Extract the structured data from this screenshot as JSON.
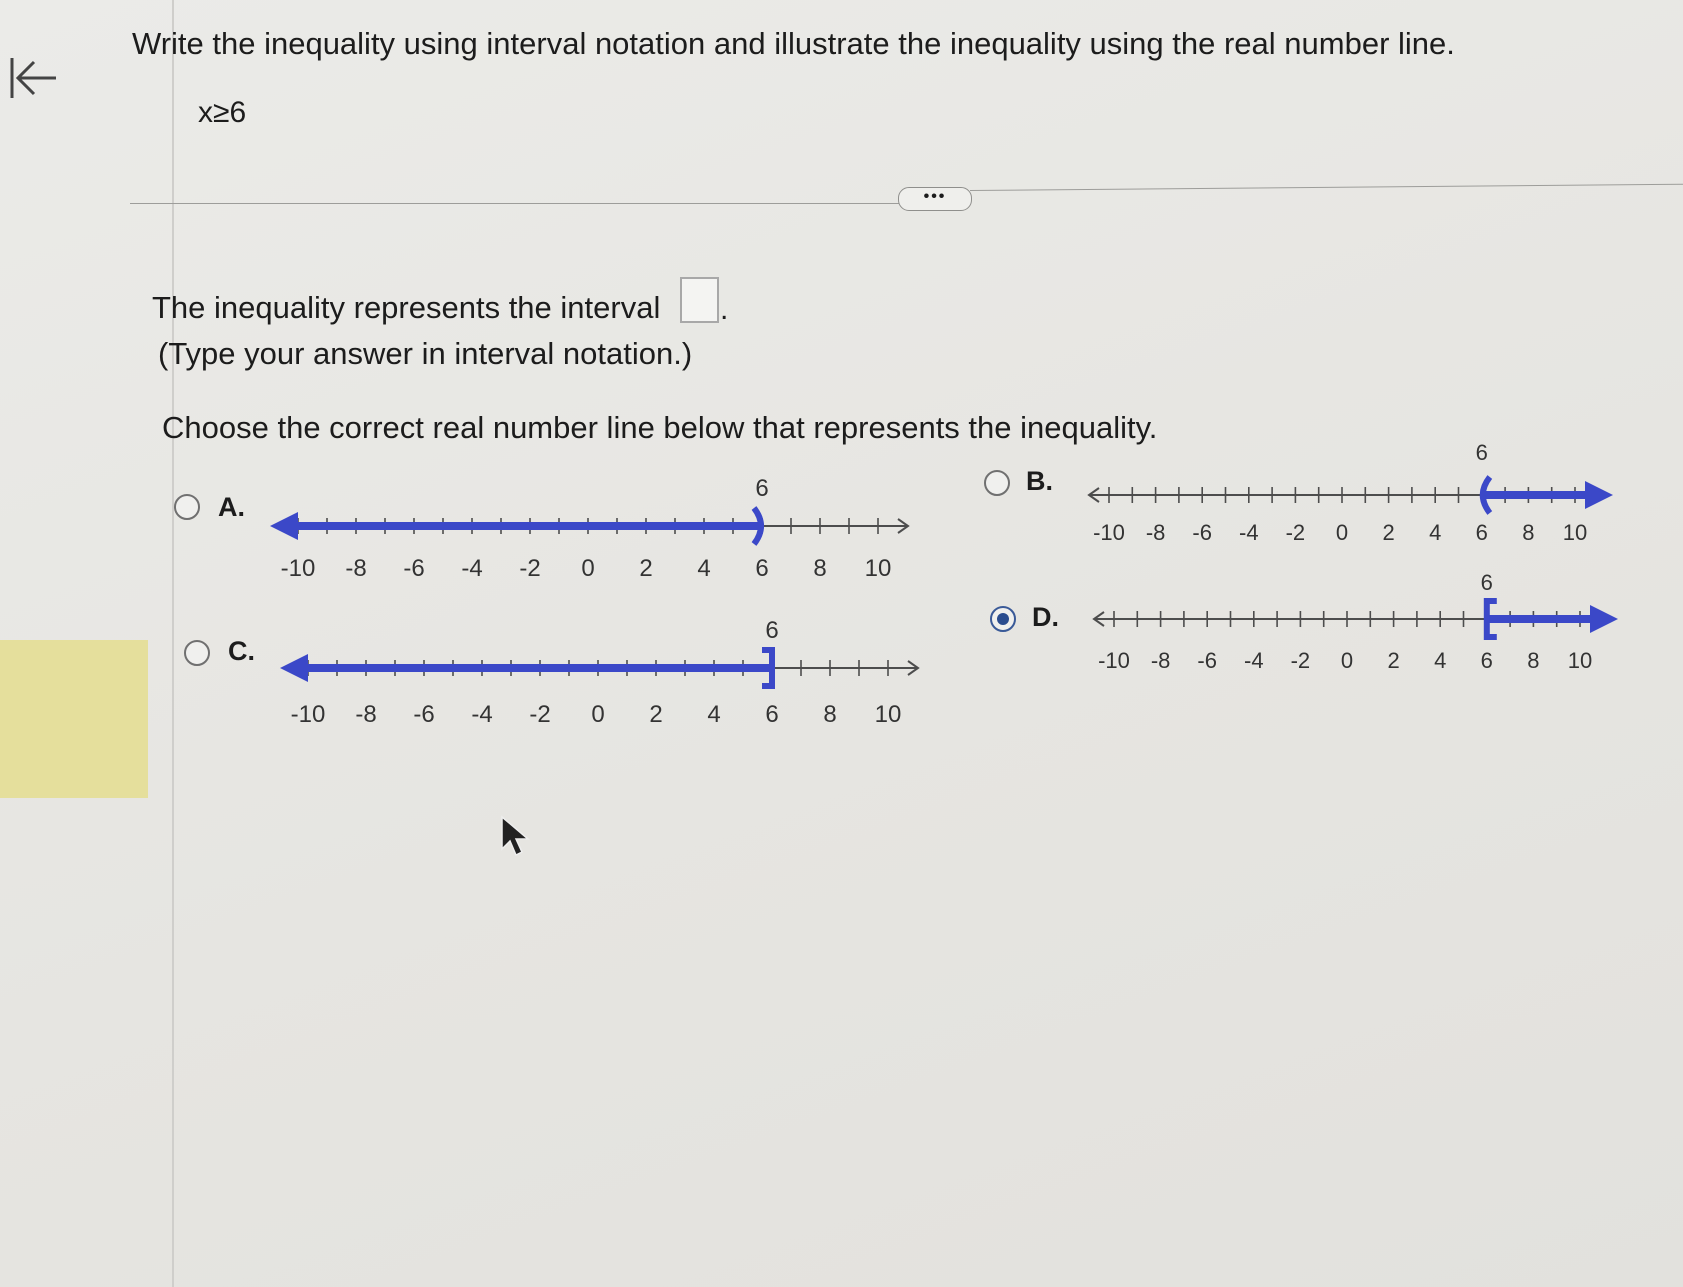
{
  "page": {
    "question": "Write the inequality using interval notation and illustrate the inequality using the real number line.",
    "inequality": "x≥6",
    "more_label": "•••",
    "interval_prompt": "The inequality represents the interval",
    "interval_answer": "",
    "interval_suffix": ".",
    "interval_hint": "(Type your answer in interval notation.)",
    "choose_prompt": "Choose the correct real number line below that represents the inequality."
  },
  "options": [
    {
      "letter": "A.",
      "selected": false,
      "callout": "6",
      "endpoint": "open-paren",
      "direction": "left",
      "ticks": [
        "-10",
        "-8",
        "-6",
        "-4",
        "-2",
        "0",
        "2",
        "4",
        "6",
        "8",
        "10"
      ]
    },
    {
      "letter": "B.",
      "selected": false,
      "callout": "6",
      "endpoint": "open-paren",
      "direction": "right",
      "ticks": [
        "-10",
        "-8",
        "-6",
        "-4",
        "-2",
        "0",
        "2",
        "4",
        "6",
        "8",
        "10"
      ]
    },
    {
      "letter": "C.",
      "selected": false,
      "callout": "6",
      "endpoint": "closed-bracket",
      "direction": "left",
      "ticks": [
        "-10",
        "-8",
        "-6",
        "-4",
        "-2",
        "0",
        "2",
        "4",
        "6",
        "8",
        "10"
      ]
    },
    {
      "letter": "D.",
      "selected": true,
      "callout": "6",
      "endpoint": "closed-bracket",
      "direction": "right",
      "ticks": [
        "-10",
        "-8",
        "-6",
        "-4",
        "-2",
        "0",
        "2",
        "4",
        "6",
        "8",
        "10"
      ]
    }
  ],
  "colors": {
    "shade": "#3b48c8",
    "axis": "#4d4d4d"
  },
  "icons": {
    "back": "back-to-start-icon",
    "pointer": "mouse-pointer-icon"
  }
}
